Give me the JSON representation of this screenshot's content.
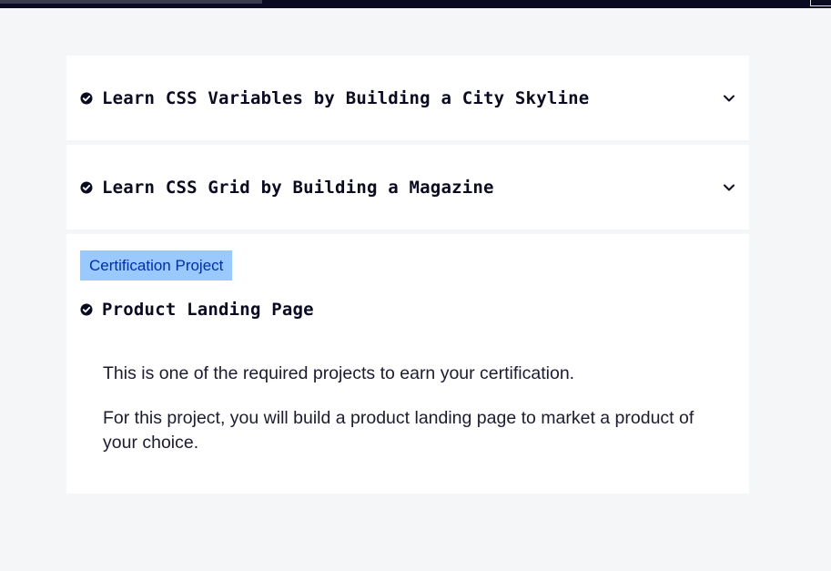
{
  "sections": [
    {
      "title": "Learn CSS Variables by Building a City Skyline",
      "completed": true,
      "expanded": false
    },
    {
      "title": "Learn CSS Grid by Building a Magazine",
      "completed": true,
      "expanded": false
    }
  ],
  "project": {
    "badge": "Certification Project",
    "title": "Product Landing Page",
    "completed": true,
    "paragraphs": [
      "This is one of the required projects to earn your certification.",
      "For this project, you will build a product landing page to market a product of your choice."
    ]
  },
  "colors": {
    "background": "#f5f6f7",
    "card": "#ffffff",
    "text": "#0a0a23",
    "badge_bg": "#99c9ff",
    "badge_text": "#002ead",
    "topbar": "#0a0a23"
  },
  "icons": {
    "completed": "check-circle-icon",
    "expand": "chevron-down-icon"
  }
}
